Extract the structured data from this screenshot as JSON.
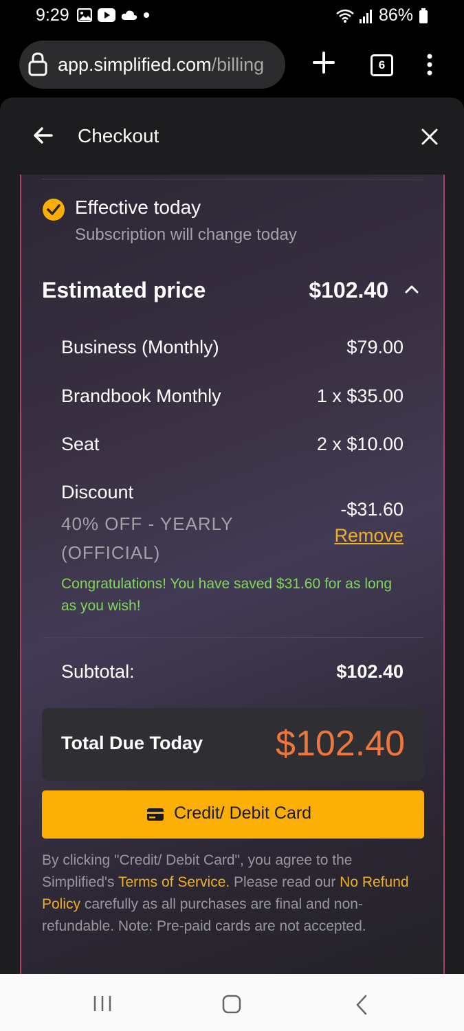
{
  "status_bar": {
    "time": "9:29",
    "battery": "86%"
  },
  "browser": {
    "url_host": "app.simplified.com",
    "url_path": "/billing",
    "tab_count": "6"
  },
  "header": {
    "title": "Checkout"
  },
  "effective": {
    "title": "Effective today",
    "subtitle": "Subscription will change today"
  },
  "estimate": {
    "label": "Estimated price",
    "value": "$102.40"
  },
  "line_items": [
    {
      "label": "Business (Monthly)",
      "value": "$79.00"
    },
    {
      "label": "Brandbook Monthly",
      "value": "1 x $35.00"
    },
    {
      "label": "Seat",
      "value": "2 x $10.00"
    }
  ],
  "discount": {
    "label": "Discount",
    "description": "40% OFF - YEARLY (OFFICIAL)",
    "value": "-$31.60",
    "remove_label": "Remove",
    "congrats": "Congratulations! You have saved $31.60 for as long as you wish!"
  },
  "subtotal": {
    "label": "Subtotal:",
    "value": "$102.40"
  },
  "total": {
    "label": "Total Due Today",
    "value": "$102.40"
  },
  "pay_button": {
    "label": "Credit/ Debit Card"
  },
  "terms": {
    "part1": "By clicking \"Credit/ Debit Card\", you agree to the Simplified's ",
    "tos_link": "Terms of Service.",
    "part2": " Please read our ",
    "refund_link": "No Refund Policy",
    "part3": " carefully as all purchases are final and non-refundable. Note: Pre-paid cards are not accepted."
  },
  "colors": {
    "accent": "#fbae05",
    "total_price": "#f0773c",
    "congrats": "#7ed957",
    "card_border": "#b0406d"
  }
}
